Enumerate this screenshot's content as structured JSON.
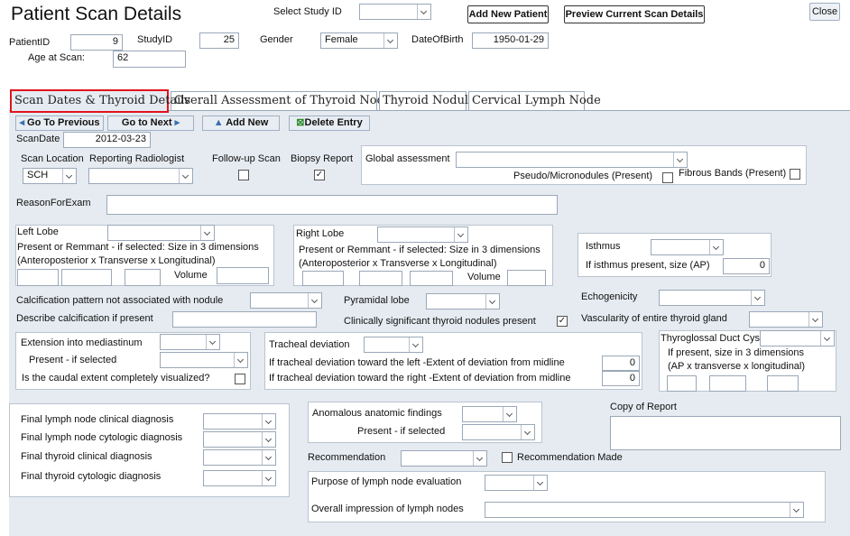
{
  "header": {
    "title": "Patient Scan Details",
    "select_study_label": "Select Study ID",
    "select_study_value": "",
    "add_new_patient": "Add New Patient",
    "preview_scan": "Preview Current Scan Details",
    "close": "Close"
  },
  "patient": {
    "patient_id_label": "PatientID",
    "patient_id": "9",
    "study_id_label": "StudyID",
    "study_id": "25",
    "gender_label": "Gender",
    "gender": "Female",
    "dob_label": "DateOfBirth",
    "dob": "1950-01-29",
    "age_label": "Age at Scan:",
    "age": "62"
  },
  "tabs": [
    {
      "label": "Scan Dates & Thyroid Details",
      "active": true
    },
    {
      "label": "Overall Assessment of Thyroid Nodule"
    },
    {
      "label": "Thyroid Nodule"
    },
    {
      "label": "Cervical Lymph Node"
    }
  ],
  "toolbar": {
    "prev": "Go To Previous",
    "next": "Go to Next",
    "add": "Add New",
    "delete": "Delete Entry"
  },
  "scan": {
    "scan_date_label": "ScanDate",
    "scan_date": "2012-03-23",
    "location_label": "Scan Location",
    "location": "SCH",
    "radiologist_label": "Reporting Radiologist",
    "radiologist": "",
    "followup_label": "Follow-up Scan",
    "biopsy_label": "Biopsy Report",
    "global_label": "Global assessment",
    "global_value": "",
    "pseudo_label": "Pseudo/Micronodules (Present)",
    "fibrous_label": "Fibrous Bands (Present)",
    "reason_label": "ReasonForExam",
    "reason_value": ""
  },
  "lobes": {
    "left_label": "Left Lobe",
    "right_label": "Right Lobe",
    "present_text": "Present or Remmant - if selected: Size in 3 dimensions",
    "dims_text": "(Anteroposterior x Transverse x Longitudinal)",
    "volume_label": "Volume",
    "isthmus_label": "Isthmus",
    "isthmus_size_label": "If isthmus present, size (AP)",
    "isthmus_size": "0"
  },
  "calc": {
    "pattern_label": "Calcification pattern not associated with nodule",
    "describe_label": "Describe calcification if present",
    "pyramidal_label": "Pyramidal lobe",
    "clinically_label": "Clinically significant thyroid nodules present",
    "echogenicity_label": "Echogenicity",
    "vascularity_label": "Vascularity of entire thyroid gland"
  },
  "extension": {
    "mediastinum_label": "Extension into mediastinum",
    "present_label": "Present - if selected",
    "caudal_label": "Is the caudal extent completely visualized?"
  },
  "tracheal": {
    "deviation_label": "Tracheal deviation",
    "left_label": "If tracheal deviation toward the left  -Extent of deviation from midline",
    "left_value": "0",
    "right_label": "If tracheal deviation toward the right -Extent of deviation from midline",
    "right_value": "0"
  },
  "thyroglossal": {
    "label": "Thyroglossal Duct Cyst",
    "size_text_1": "If present, size in 3 dimensions",
    "size_text_2": "(AP x transverse x longitudinal)"
  },
  "final": {
    "lymph_clinical": "Final lymph node clinical diagnosis",
    "lymph_cytologic": "Final lymph node cytologic diagnosis",
    "thyroid_clinical": "Final thyroid clinical diagnosis",
    "thyroid_cytologic": "Final thyroid cytologic diagnosis"
  },
  "anomalous": {
    "label": "Anomalous anatomic findings",
    "present_label": "Present - if selected"
  },
  "report": {
    "copy_label": "Copy of Report",
    "recommendation_label": "Recommendation",
    "recommendation_made_label": "Recommendation Made",
    "purpose_label": "Purpose of lymph node evaluation",
    "impression_label": "Overall impression of lymph nodes"
  },
  "colors": {
    "form_bg": "#e6ebf1",
    "highlight": "#e0141d"
  }
}
